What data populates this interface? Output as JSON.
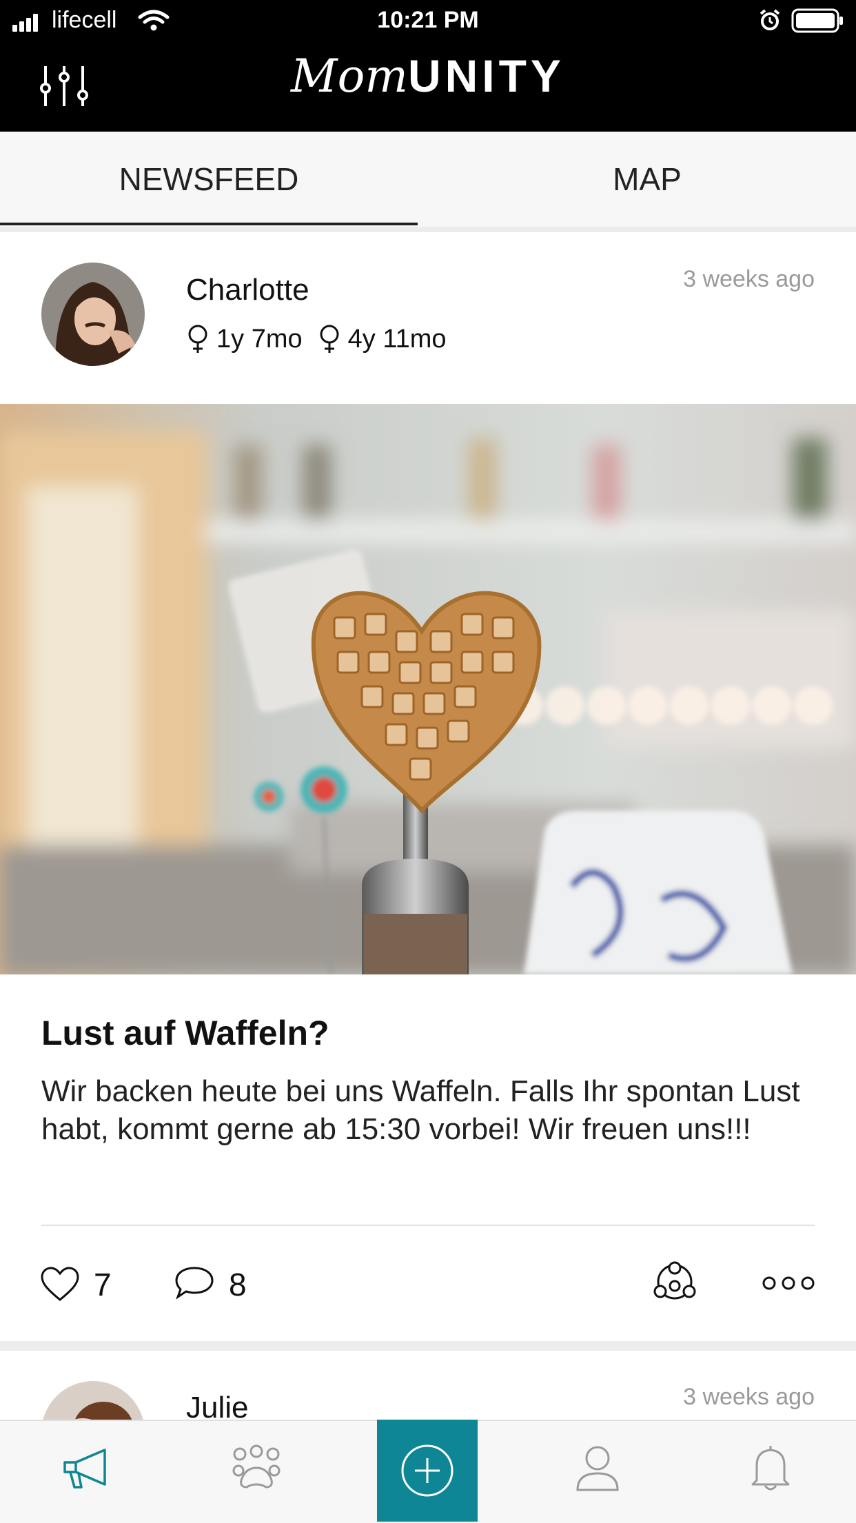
{
  "status_bar": {
    "carrier": "lifecell",
    "time": "10:21 PM"
  },
  "header": {
    "logo_script": "Mom",
    "logo_caps": "UNITY"
  },
  "tabs": [
    {
      "label": "NEWSFEED",
      "active": true
    },
    {
      "label": "MAP",
      "active": false
    }
  ],
  "posts": [
    {
      "author": "Charlotte",
      "time": "3 weeks ago",
      "kids": [
        "1y 7mo",
        "4y 11mo"
      ],
      "title": "Lust auf Waffeln?",
      "body": "Wir backen heute bei uns Waffeln. Falls Ihr spontan Lust habt, kommt gerne ab 15:30 vorbei! Wir freuen uns!!!",
      "likes": "7",
      "comments": "8"
    },
    {
      "author": "Julie",
      "time": "3 weeks ago"
    }
  ],
  "colors": {
    "accent": "#0e8695",
    "header_bg": "#000000",
    "muted": "#9a9a9a"
  },
  "icons": {
    "filter": "sliders-icon",
    "like": "heart-icon",
    "comment": "comment-icon",
    "share": "network-icon",
    "more": "more-icon",
    "nav": [
      "megaphone-icon",
      "paw-group-icon",
      "add-icon",
      "profile-icon",
      "bell-icon"
    ]
  }
}
